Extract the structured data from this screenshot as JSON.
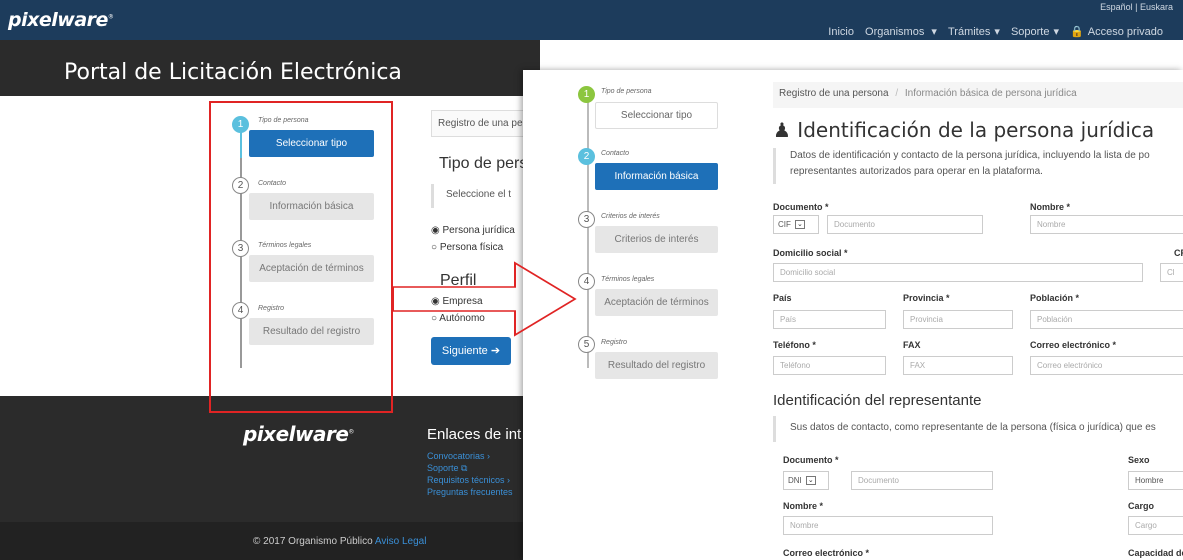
{
  "header": {
    "logo": "pixelware",
    "logo_mark": "®",
    "lang": "Español | Euskara",
    "nav": {
      "inicio": "Inicio",
      "organismos": "Organismos",
      "tramites": "Trámites",
      "soporte": "Soporte",
      "acceso": "Acceso privado"
    }
  },
  "hero": {
    "title": "Portal de Licitación Electrónica"
  },
  "left_steps": [
    {
      "num": "1",
      "label": "Tipo de persona",
      "button": "Seleccionar tipo"
    },
    {
      "num": "2",
      "label": "Contacto",
      "button": "Información básica"
    },
    {
      "num": "3",
      "label": "Términos legales",
      "button": "Aceptación de términos"
    },
    {
      "num": "4",
      "label": "Registro",
      "button": "Resultado del registro"
    }
  ],
  "left_form": {
    "breadcrumb": "Registro de una pe",
    "title": "Tipo de pers",
    "note": "Seleccione el t",
    "radio_juridica": "Persona jurídica",
    "radio_fisica": "Persona física",
    "perfil": "Perfil",
    "radio_empresa": "Empresa",
    "radio_autonomo": "Autónomo",
    "next": "Siguiente"
  },
  "footer": {
    "logo": "pixelware",
    "links_title": "Enlaces de int",
    "links": [
      "Convocatorias",
      "Soporte",
      "Requisitos técnicos",
      "Preguntas frecuentes"
    ],
    "copyright": "© 2017 Organismo Público",
    "aviso": "Aviso Legal"
  },
  "right_steps": [
    {
      "num": "1",
      "label": "Tipo de persona",
      "button": "Seleccionar tipo"
    },
    {
      "num": "2",
      "label": "Contacto",
      "button": "Información básica"
    },
    {
      "num": "3",
      "label": "Criterios de interés",
      "button": "Criterios de interés"
    },
    {
      "num": "4",
      "label": "Términos legales",
      "button": "Aceptación de términos"
    },
    {
      "num": "5",
      "label": "Registro",
      "button": "Resultado del registro"
    }
  ],
  "panel": {
    "breadcrumb_1": "Registro de una persona",
    "breadcrumb_sep": "/",
    "breadcrumb_2": "Información básica de persona jurídica",
    "title": "Identificación de la persona jurídica",
    "note_line1": "Datos de identificación y contacto de la persona jurídica, incluyendo la lista de po",
    "note_line2": "representantes autorizados para operar en la plataforma.",
    "doc_label": "Documento *",
    "doc_type": "CIF",
    "doc_ph": "Documento",
    "nombre_label": "Nombre *",
    "nombre_ph": "Nombre",
    "dom_label": "Domicilio social *",
    "dom_ph": "Domicilio social",
    "cp_label": "CP",
    "cp_ph": "Cl",
    "pais_label": "País",
    "pais_ph": "País",
    "prov_label": "Provincia *",
    "prov_ph": "Provincia",
    "pob_label": "Población *",
    "pob_ph": "Población",
    "tel_label": "Teléfono *",
    "tel_ph": "Teléfono",
    "fax_label": "FAX",
    "fax_ph": "FAX",
    "email_label": "Correo electrónico *",
    "email_ph": "Correo electrónico",
    "rep_title": "Identificación del representante",
    "rep_note": "Sus datos de contacto, como representante de la persona (física o jurídica) que es",
    "rdoc_label": "Documento *",
    "rdoc_type": "DNI",
    "rdoc_ph": "Documento",
    "sexo_label": "Sexo",
    "sexo_val": "Hombre",
    "rnombre_label": "Nombre *",
    "rnombre_ph": "Nombre",
    "cargo_label": "Cargo",
    "cargo_ph": "Cargo",
    "remail_label": "Correo electrónico *",
    "capacidad_label": "Capacidad de"
  },
  "colors": {
    "header": "#1d3c5c",
    "active": "#1e70b8",
    "step_active": "#5bc0de",
    "step_done": "#8cc63f",
    "annotation": "#e02424"
  }
}
